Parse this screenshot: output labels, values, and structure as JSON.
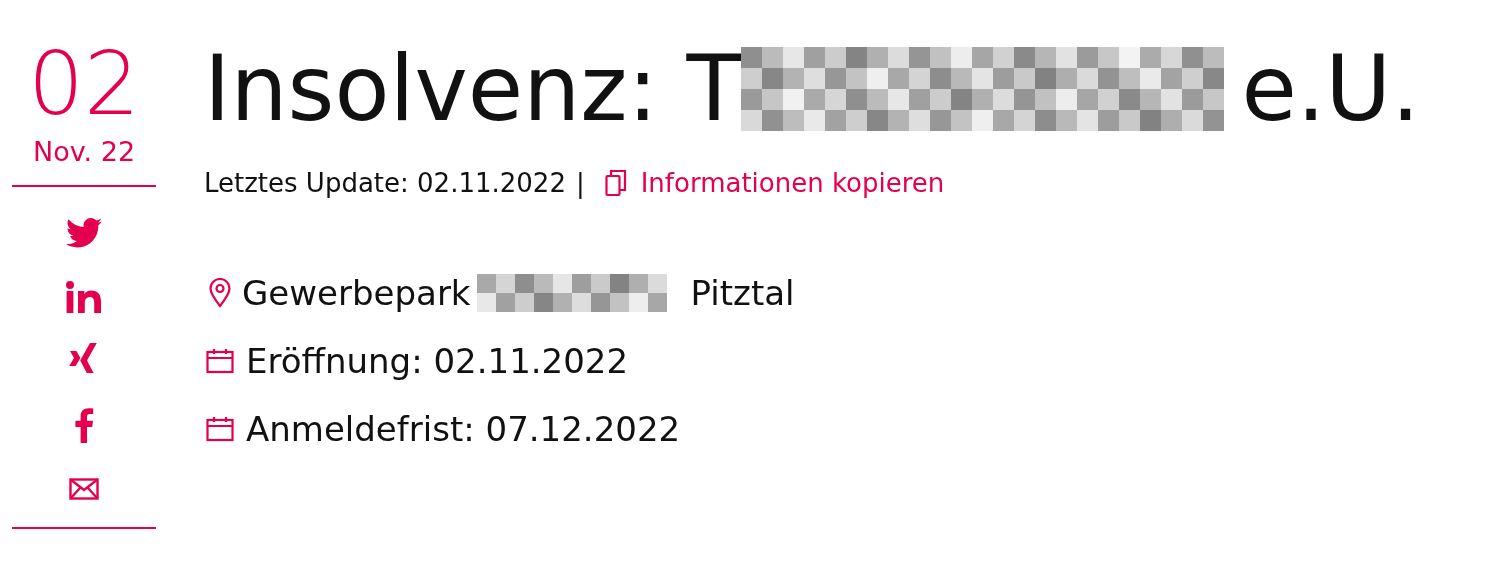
{
  "date": {
    "day": "02",
    "month": "Nov. 22"
  },
  "share": [
    {
      "kind": "twitter"
    },
    {
      "kind": "linkedin"
    },
    {
      "kind": "xing"
    },
    {
      "kind": "facebook"
    },
    {
      "kind": "mail"
    }
  ],
  "title": {
    "start": "Insolvenz: T",
    "end": "e.U."
  },
  "meta": {
    "update": "Letztes Update: 02.11.2022",
    "separator": "|",
    "copy_link": "Informationen kopieren"
  },
  "details": [
    {
      "kind": "location",
      "text_before": "Gewerbepark",
      "text_after": "Pitztal"
    },
    {
      "kind": "date",
      "text": "Eröffnung: 02.11.2022"
    },
    {
      "kind": "date",
      "text": "Anmeldefrist: 07.12.2022"
    }
  ]
}
